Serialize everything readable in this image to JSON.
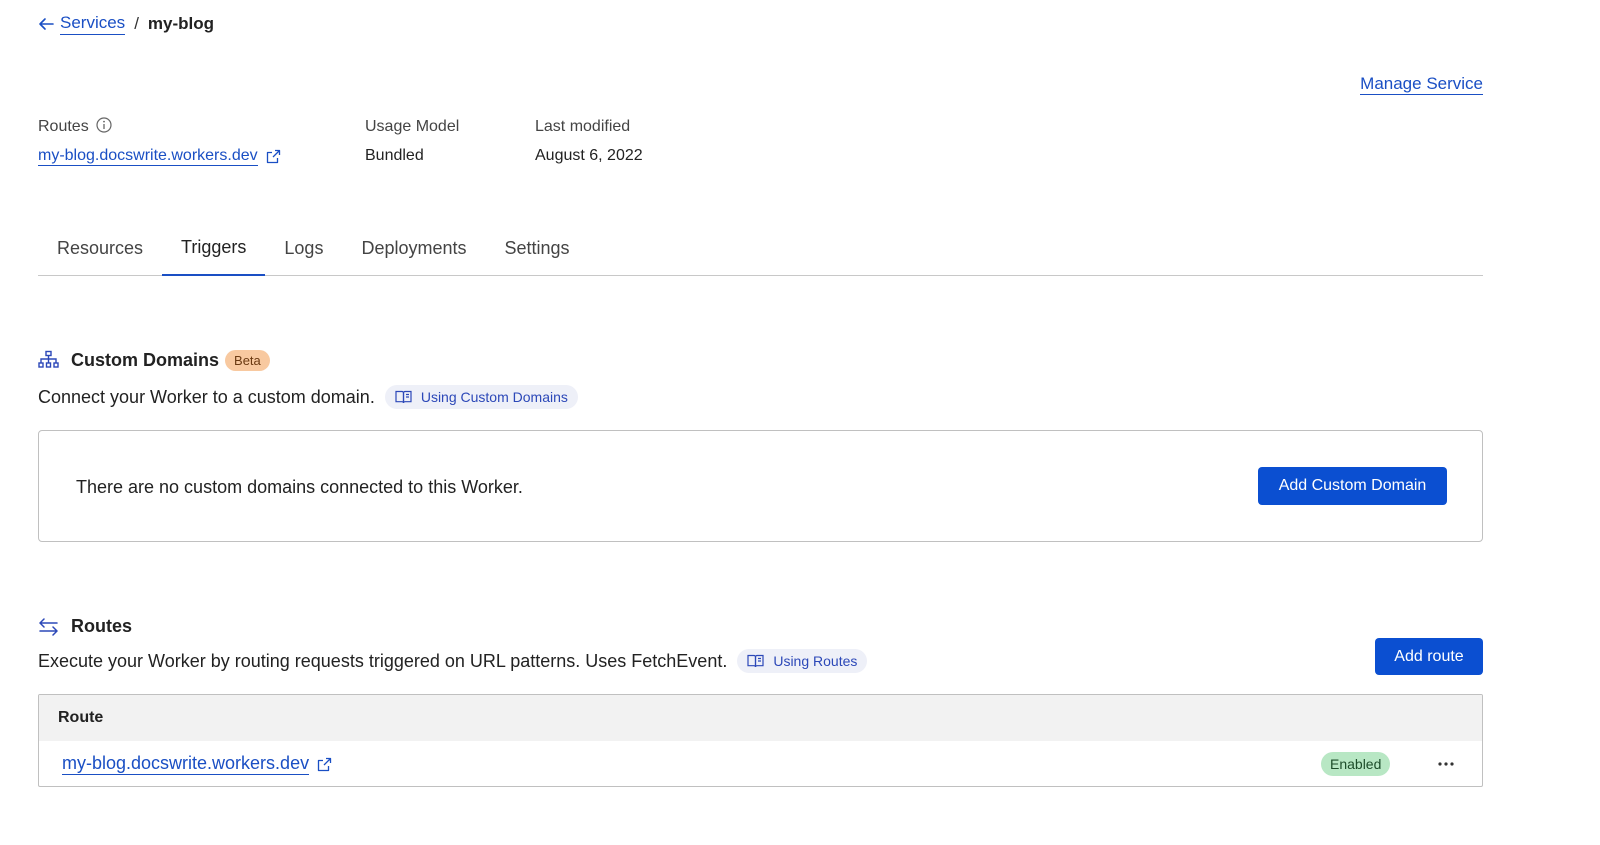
{
  "breadcrumb": {
    "back_label": "Services",
    "separator": "/",
    "current": "my-blog"
  },
  "header": {
    "manage_label": "Manage Service"
  },
  "meta": {
    "routes_label": "Routes",
    "routes_value": "my-blog.docswrite.workers.dev",
    "usage_label": "Usage Model",
    "usage_value": "Bundled",
    "modified_label": "Last modified",
    "modified_value": "August 6, 2022"
  },
  "tabs": [
    {
      "label": "Resources",
      "active": false
    },
    {
      "label": "Triggers",
      "active": true
    },
    {
      "label": "Logs",
      "active": false
    },
    {
      "label": "Deployments",
      "active": false
    },
    {
      "label": "Settings",
      "active": false
    }
  ],
  "custom_domains": {
    "title": "Custom Domains",
    "badge": "Beta",
    "description": "Connect your Worker to a custom domain.",
    "doc_link": "Using Custom Domains",
    "empty_text": "There are no custom domains connected to this Worker.",
    "add_button": "Add Custom Domain"
  },
  "routes": {
    "title": "Routes",
    "description": "Execute your Worker by routing requests triggered on URL patterns. Uses FetchEvent.",
    "doc_link": "Using Routes",
    "add_button": "Add route",
    "table_header": "Route",
    "rows": [
      {
        "route": "my-blog.docswrite.workers.dev",
        "status": "Enabled"
      }
    ]
  },
  "colors": {
    "accent": "#0b4fd1",
    "link": "#1a4fc4",
    "beta_badge": "#f8c9a0",
    "enabled_badge": "#b8e7c4"
  },
  "icons": {
    "back": "arrow-left-icon",
    "info": "info-icon",
    "external": "external-link-icon",
    "custom_domains": "sitemap-icon",
    "routes": "swap-arrows-icon",
    "docs": "book-icon",
    "more": "more-horizontal-icon"
  }
}
